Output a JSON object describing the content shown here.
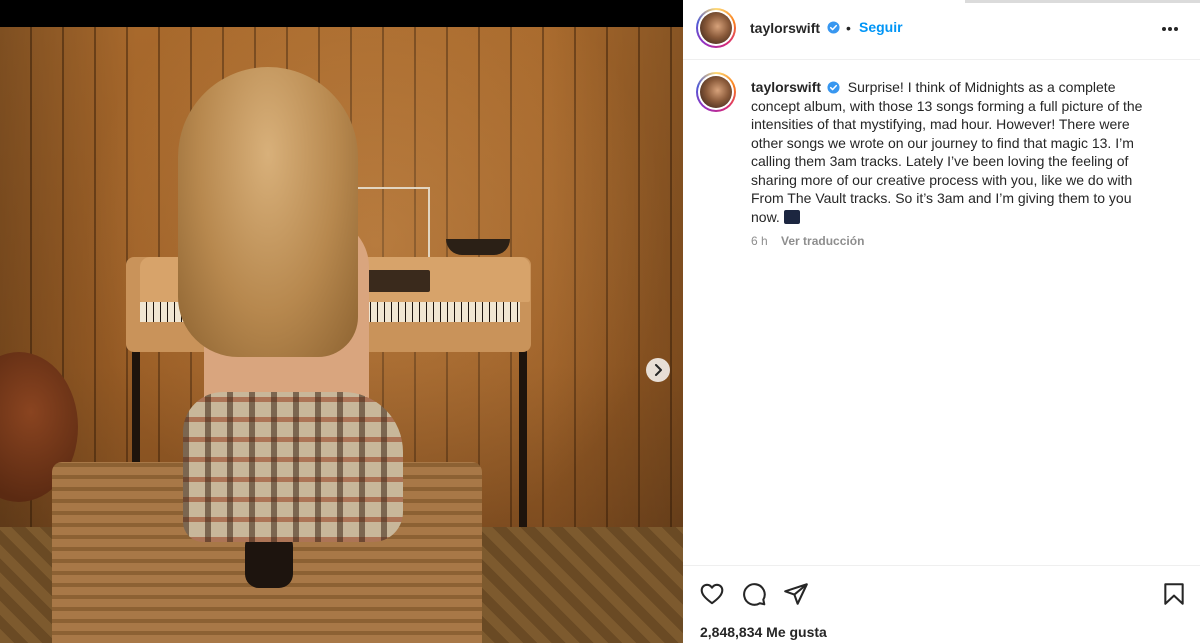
{
  "post": {
    "username": "taylorswift",
    "dot": "•",
    "follow_label": "Seguir",
    "caption": "Surprise! I think of Midnights as a complete concept album, with those 13 songs forming a full picture of the intensities of that mystifying, mad hour. However! There were other songs we wrote on our journey to find that magic 13. I’m calling them 3am tracks. Lately I’ve been loving the feeling of sharing more of our creative process with you, like we do with From The Vault tracks. So it’s 3am and I’m giving them to you now.",
    "time": "6 h",
    "translate_label": "Ver traducción",
    "likes": "2,848,834 Me gusta"
  },
  "icons": {
    "verified": "verified-badge-icon",
    "more": "more-options-icon",
    "next": "chevron-right-icon",
    "like": "heart-icon",
    "comment": "comment-icon",
    "share": "share-icon",
    "save": "bookmark-icon",
    "caption_emoji": "moon-emoji-icon"
  },
  "colors": {
    "link_blue": "#0095f6",
    "verified_blue": "#3897f0",
    "meta_gray": "#8e8e8e"
  }
}
